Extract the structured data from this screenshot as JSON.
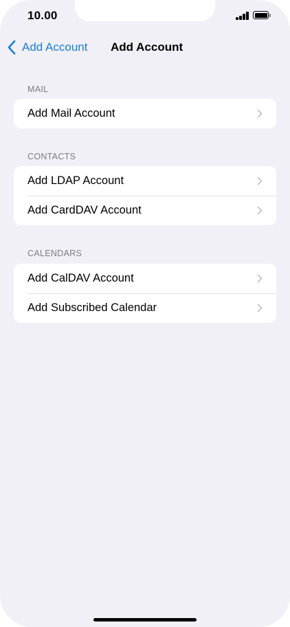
{
  "status_bar": {
    "time": "10.00",
    "signal_icon": "cellular-signal-icon",
    "battery_icon": "battery-icon"
  },
  "nav": {
    "back_label": "Add Account",
    "back_icon": "chevron-left-icon",
    "title": "Add Account",
    "accent_color": "#1a7fd4"
  },
  "sections": [
    {
      "header": "MAIL",
      "items": [
        {
          "label": "Add Mail Account"
        }
      ]
    },
    {
      "header": "CONTACTS",
      "items": [
        {
          "label": "Add LDAP Account"
        },
        {
          "label": "Add CardDAV Account"
        }
      ]
    },
    {
      "header": "CALENDARS",
      "items": [
        {
          "label": "Add CalDAV Account"
        },
        {
          "label": "Add Subscribed Calendar"
        }
      ]
    }
  ]
}
